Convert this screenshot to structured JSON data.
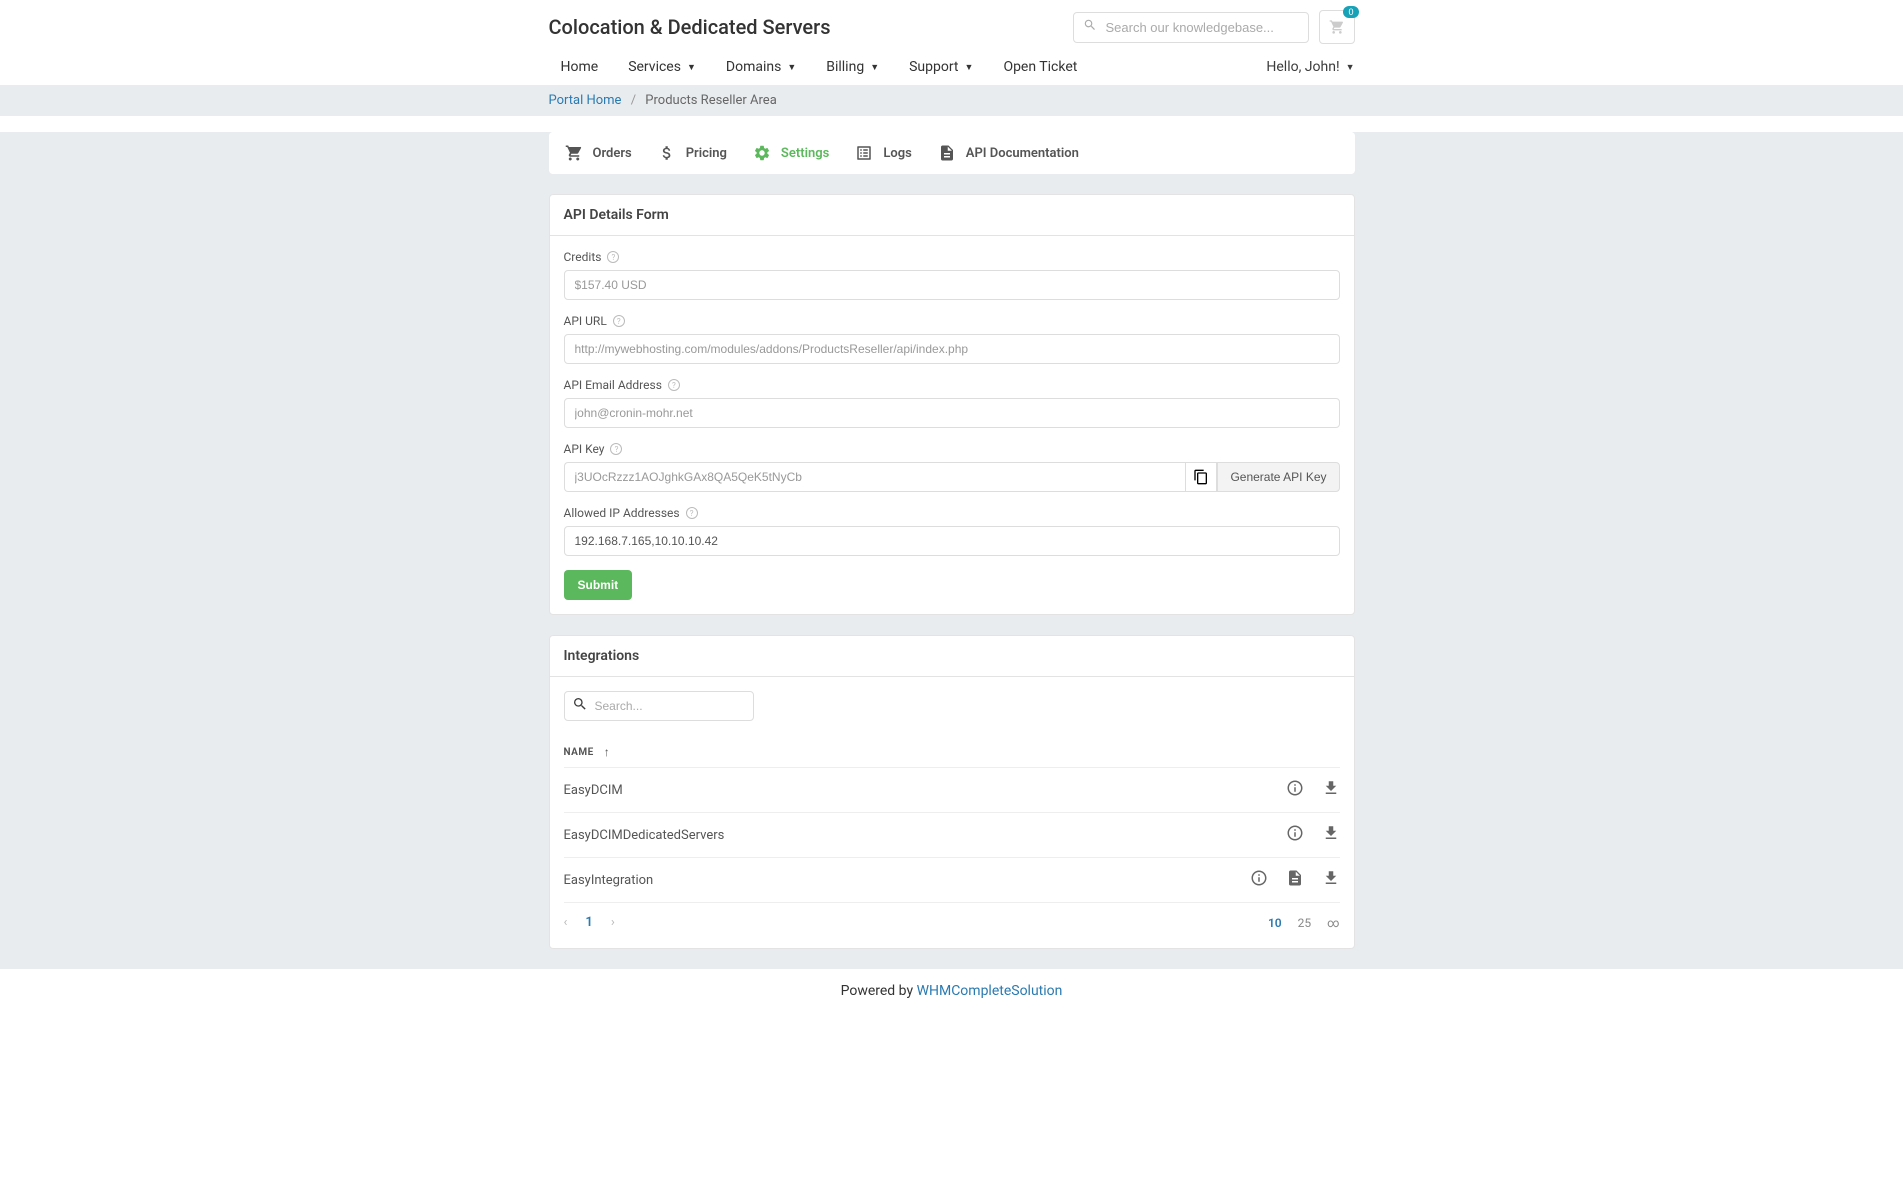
{
  "brand": "Colocation & Dedicated Servers",
  "search_placeholder": "Search our knowledgebase...",
  "cart_count": "0",
  "nav": {
    "home": "Home",
    "services": "Services",
    "domains": "Domains",
    "billing": "Billing",
    "support": "Support",
    "open_ticket": "Open Ticket"
  },
  "user_greeting": "Hello, John!",
  "breadcrumb": {
    "home": "Portal Home",
    "current": "Products Reseller Area"
  },
  "tabs": {
    "orders": "Orders",
    "pricing": "Pricing",
    "settings": "Settings",
    "logs": "Logs",
    "api_docs": "API Documentation"
  },
  "form": {
    "title": "API Details Form",
    "credits_label": "Credits",
    "credits_value": "$157.40 USD",
    "apiurl_label": "API URL",
    "apiurl_value": "http://mywebhosting.com/modules/addons/ProductsReseller/api/index.php",
    "email_label": "API Email Address",
    "email_value": "john@cronin-mohr.net",
    "apikey_label": "API Key",
    "apikey_value": "j3UOcRzzz1AOJghkGAx8QA5QeK5tNyCb",
    "generate_btn": "Generate API Key",
    "allowed_ip_label": "Allowed IP Addresses",
    "allowed_ip_value": "192.168.7.165,10.10.10.42",
    "submit": "Submit"
  },
  "integrations": {
    "title": "Integrations",
    "search_placeholder": "Search...",
    "name_col": "NAME",
    "rows": [
      "EasyDCIM",
      "EasyDCIMDedicatedServers",
      "EasyIntegration"
    ],
    "page_current": "1",
    "page_size_10": "10",
    "page_size_25": "25",
    "page_size_inf": "∞"
  },
  "footer": {
    "text": "Powered by ",
    "link": "WHMCompleteSolution"
  }
}
